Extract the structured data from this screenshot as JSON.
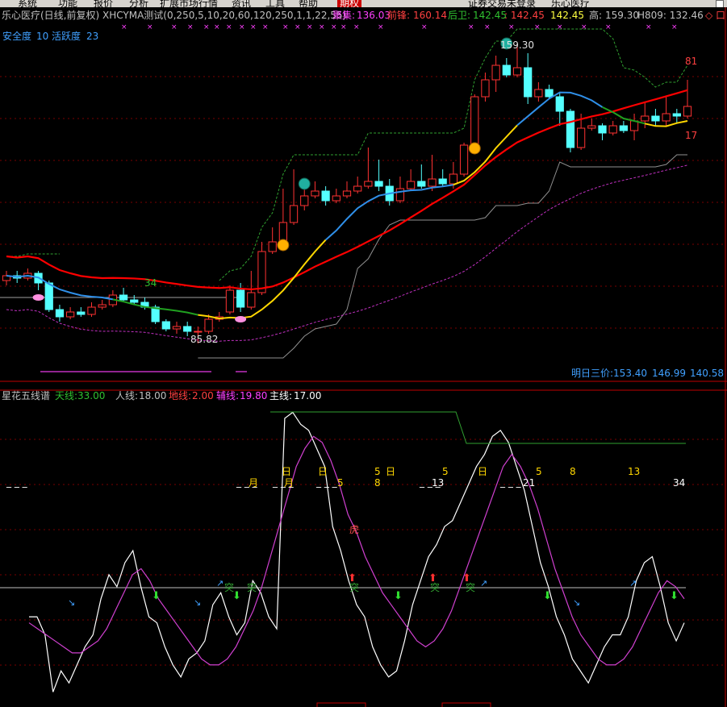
{
  "menubar": {
    "items": [
      {
        "label": "系统"
      },
      {
        "label": "功能"
      },
      {
        "label": "报价"
      },
      {
        "label": "分析"
      },
      {
        "label": "扩展市场行情"
      },
      {
        "label": "资讯"
      },
      {
        "label": "工具"
      },
      {
        "label": "帮助"
      },
      {
        "label": "期权",
        "active": true
      },
      {
        "label": "证券交易未登录"
      },
      {
        "label": "乐心医疗"
      }
    ]
  },
  "main_panel": {
    "header": {
      "title": "乐心医疗(日线,前复权) XHCYMA测试(0,250,5,10,20,60,120,250,1,1,22,55)",
      "juji_label": "聚集:",
      "juji_value": "136.03",
      "qianfeng_label": "前锋:",
      "qianfeng_value": "160.14",
      "houwei_label": "后卫:",
      "houwei_value": "142.45",
      "extra_value": ": 142.45",
      "extra_value2": "142.45",
      "high_label": "高:",
      "high_value": "159.30",
      "h809": "H809: 132.46",
      "marker": "◇ 口"
    },
    "safety_label": "安全度",
    "safety_value": "10",
    "active_label": "活跃度",
    "active_value": "23",
    "label_high": "159.30",
    "label_low": "85.82",
    "label_34": "34",
    "label_81": "81",
    "label_17": "17",
    "tomorrow_label": "明日三价:153.40",
    "tomorrow_v2": "146.99",
    "tomorrow_v3": "140.58"
  },
  "sub_panel": {
    "title": "星花五线谱",
    "tian_label": "天线:",
    "tian_value": "33.00",
    "ren_label": "人线:",
    "ren_value": "18.00",
    "di_label": "地线:",
    "di_value": "2.00",
    "fu_label": "辅线:",
    "fu_value": "19.80",
    "zhu_label": "主线:",
    "zhu_value": "17.00",
    "labels": {
      "yue": "月",
      "ri": "日",
      "tu": "突",
      "hu": "虎",
      "n5": "5",
      "n8": "8",
      "n13": "13",
      "n21": "21",
      "n34": "34"
    }
  },
  "chart_data": {
    "type": "candlestick",
    "colors": {
      "up": "#ff3232",
      "down": "#54ffff",
      "ma_red": "#ff0000",
      "ma_blue": "#2f8fe8",
      "ma_yellow": "#ffd700",
      "ma_green": "#20a020",
      "magenta": "#c030c0",
      "white": "#ffffff"
    },
    "candles": [
      [
        112,
        114,
        116,
        110
      ],
      [
        114,
        113,
        116,
        111
      ],
      [
        113,
        115,
        117,
        112
      ],
      [
        115,
        111,
        116,
        108
      ],
      [
        111,
        100,
        112,
        99
      ],
      [
        100,
        97,
        102,
        95
      ],
      [
        97,
        99,
        101,
        96
      ],
      [
        99,
        98,
        101,
        97
      ],
      [
        98,
        101,
        103,
        97
      ],
      [
        101,
        102,
        104,
        100
      ],
      [
        102,
        106,
        108,
        101
      ],
      [
        106,
        104,
        109,
        103
      ],
      [
        104,
        103,
        106,
        102
      ],
      [
        103,
        101,
        105,
        100
      ],
      [
        101,
        95,
        102,
        94
      ],
      [
        95,
        92,
        96,
        91
      ],
      [
        92,
        93,
        95,
        90
      ],
      [
        93,
        91,
        95,
        89
      ],
      [
        91,
        91,
        93,
        86
      ],
      [
        91,
        96,
        98,
        90
      ],
      [
        96,
        97,
        99,
        95
      ],
      [
        99,
        108,
        110,
        98
      ],
      [
        108,
        101,
        111,
        99
      ],
      [
        101,
        107,
        116,
        100
      ],
      [
        107,
        124,
        128,
        106
      ],
      [
        124,
        128,
        134,
        123
      ],
      [
        128,
        136,
        150,
        127
      ],
      [
        136,
        143,
        158,
        135
      ],
      [
        143,
        147,
        152,
        141
      ],
      [
        147,
        149,
        153,
        146
      ],
      [
        149,
        145,
        151,
        143
      ],
      [
        145,
        147,
        150,
        144
      ],
      [
        147,
        149,
        153,
        146
      ],
      [
        149,
        151,
        155,
        148
      ],
      [
        151,
        153,
        167,
        150
      ],
      [
        153,
        151,
        162,
        149
      ],
      [
        151,
        145,
        154,
        143
      ],
      [
        145,
        150,
        155,
        144
      ],
      [
        150,
        153,
        158,
        149
      ],
      [
        153,
        151,
        160,
        150
      ],
      [
        151,
        154,
        164,
        149
      ],
      [
        154,
        152,
        158,
        151
      ],
      [
        152,
        156,
        161,
        150
      ],
      [
        156,
        168,
        169,
        155
      ],
      [
        168,
        188,
        189,
        167
      ],
      [
        188,
        195,
        198,
        186
      ],
      [
        195,
        201,
        205,
        190
      ],
      [
        201,
        197,
        204,
        196
      ],
      [
        197,
        200,
        210,
        196
      ],
      [
        200,
        188,
        206,
        185
      ],
      [
        188,
        191,
        194,
        186
      ],
      [
        191,
        188,
        193,
        187
      ],
      [
        188,
        182,
        190,
        176
      ],
      [
        182,
        167,
        183,
        165
      ],
      [
        167,
        175,
        181,
        166
      ],
      [
        175,
        176,
        179,
        174
      ],
      [
        176,
        173,
        177,
        170
      ],
      [
        173,
        176,
        178,
        172
      ],
      [
        176,
        174,
        178,
        173
      ],
      [
        174,
        178,
        181,
        170
      ],
      [
        178,
        180,
        186,
        175
      ],
      [
        180,
        178,
        183,
        176
      ],
      [
        178,
        181,
        188,
        176
      ],
      [
        181,
        180,
        183,
        177
      ],
      [
        180,
        184,
        195,
        179
      ]
    ],
    "series": [
      {
        "name": "主线",
        "value": 17.0
      },
      {
        "name": "辅线",
        "value": 19.8
      },
      {
        "name": "天线",
        "value": 33.0
      },
      {
        "name": "人线",
        "value": 18.0
      },
      {
        "name": "地线",
        "value": 2.0
      }
    ],
    "osc_white": [
      30,
      30,
      24,
      5,
      12,
      8,
      14,
      20,
      24,
      36,
      44,
      40,
      48,
      52,
      40,
      30,
      28,
      20,
      14,
      10,
      16,
      18,
      22,
      34,
      38,
      30,
      24,
      28,
      42,
      38,
      30,
      26,
      96,
      98,
      94,
      92,
      86,
      80,
      60,
      52,
      42,
      34,
      30,
      20,
      14,
      10,
      12,
      22,
      34,
      42,
      50,
      54,
      60,
      62,
      68,
      74,
      80,
      84,
      90,
      92,
      88,
      80,
      72,
      60,
      48,
      40,
      30,
      24,
      16,
      12,
      8,
      14,
      20,
      24,
      24,
      30,
      42,
      48,
      50,
      40,
      28,
      22,
      28
    ],
    "osc_magenta": [
      28,
      26,
      24,
      22,
      20,
      18,
      18,
      20,
      22,
      26,
      32,
      38,
      44,
      46,
      42,
      36,
      32,
      28,
      24,
      20,
      16,
      14,
      14,
      16,
      20,
      26,
      32,
      40,
      50,
      60,
      70,
      80,
      86,
      90,
      88,
      82,
      74,
      64,
      58,
      50,
      44,
      38,
      34,
      30,
      26,
      22,
      20,
      22,
      26,
      32,
      40,
      48,
      56,
      64,
      72,
      80,
      84,
      80,
      74,
      66,
      56,
      46,
      38,
      30,
      24,
      20,
      16,
      14,
      14,
      16,
      20,
      26,
      32,
      38,
      42,
      40,
      36
    ]
  }
}
